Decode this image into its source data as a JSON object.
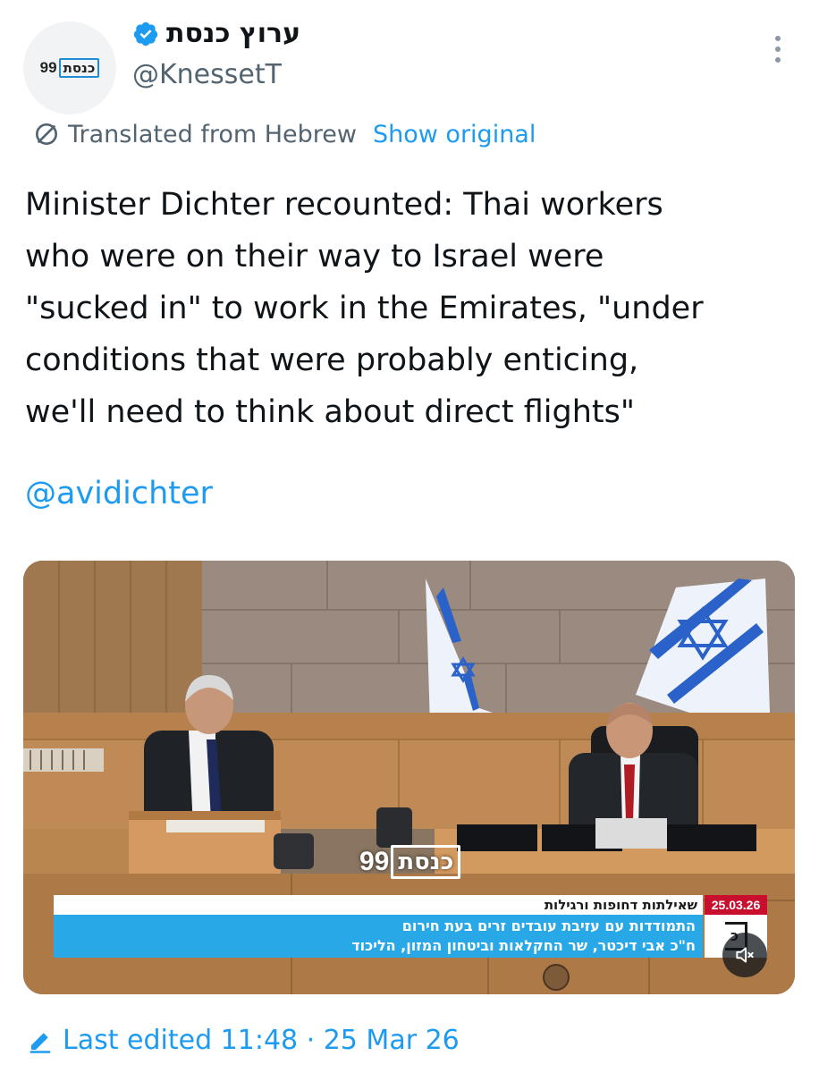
{
  "author": {
    "display_name": "ערוץ כנסת",
    "handle": "@KnessetT",
    "avatar_logo_number": "99",
    "avatar_logo_text": "כנסת",
    "verified_icon": "verified-badge-icon"
  },
  "translation": {
    "label": "Translated from Hebrew",
    "action": "Show original"
  },
  "tweet": {
    "text": "Minister Dichter recounted: Thai workers\nwho were on their way to Israel were\n\"sucked in\" to work in the Emirates, \"under\nconditions that were probably enticing,\nwe'll need to think about direct flights\"",
    "mention": "@avidichter"
  },
  "media": {
    "watermark_number": "99",
    "watermark_text": "כנסת",
    "ticker_heading": "שאילתות דחופות ורגילות",
    "ticker_date": "25.03.26",
    "ticker_line1": "התמודדות עם עזיבת עובדים זרים בעת חירום",
    "ticker_line2": "ח\"כ אבי דיכטר, שר החקלאות וביטחון המזון, הליכוד",
    "ticker_logo_glyph": "כ",
    "mute_icon": "speaker-muted-icon"
  },
  "footer": {
    "edited_label": "Last edited 11:48 · 25 Mar 26"
  },
  "colors": {
    "link": "#1d9bf0",
    "secondary_text": "#536471",
    "ticker_blue": "#29a8e8",
    "ticker_red": "#c8102e"
  }
}
